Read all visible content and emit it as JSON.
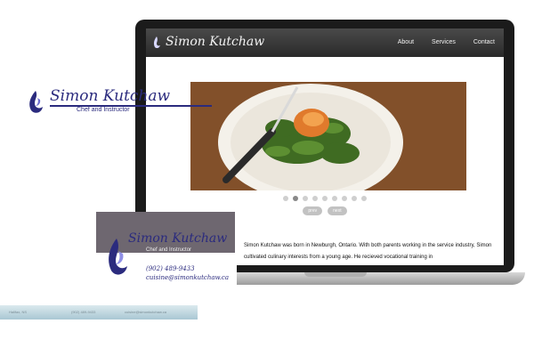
{
  "site": {
    "title": "Simon Kutchaw",
    "nav": [
      "About",
      "Services",
      "Contact"
    ],
    "slider": {
      "total": 9,
      "active_index": 1,
      "prev_label": "prev",
      "next_label": "next"
    },
    "bio": "Simon Kutchaw was born in Newburgh, Ontario. With both parents working in the service industry, Simon cultivated culinary interests from a young age. He recieved vocational training in"
  },
  "logo": {
    "name": "Simon Kutchaw",
    "tagline": "Chef and Instructor"
  },
  "business_card": {
    "name": "Simon Kutchaw",
    "tagline": "Chef and Instructor",
    "phone": "(902) 489-9433",
    "email": "cuisine@simonkutchaw.ca"
  },
  "letterhead": {
    "city": "Halifax, NS",
    "phone": "(902) 489-9433",
    "email": "cuisine@simonkutchaw.ca"
  },
  "colors": {
    "brand": "#2b2b7e",
    "card_bg": "#6e6770",
    "strip_bg": "#a9c7d3"
  }
}
